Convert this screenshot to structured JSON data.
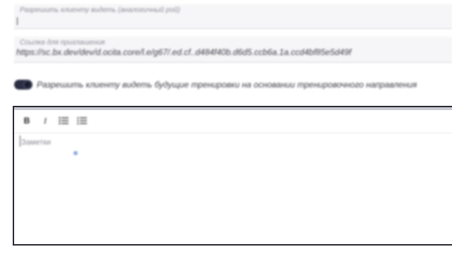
{
  "fields": {
    "field1": {
      "label": "Разрешить клиенту видеть (аналогичный рой)",
      "value": "|"
    },
    "field2": {
      "label": "Ссылка для приглашения",
      "value": "https://sc.bx.dev/dev/d.ocita.core/l.e/g67/.ed.cf..d484f40b.d6d5.ccb6a.1a.ccd4bf85e5d49f"
    }
  },
  "toggle": {
    "label": "Разрешить клиенту видеть будущие тренировки на основании тренировочного направления",
    "state": "on"
  },
  "editor": {
    "toolbar": {
      "bold_label": "B",
      "italic_label": "I",
      "bullet_list_icon": "bullet-list-icon",
      "ordered_list_icon": "ordered-list-icon"
    },
    "placeholder": "Заметки"
  },
  "colors": {
    "toggle_on": "#2b2d44",
    "field_bg": "#f6f6f8",
    "editor_border": "#2a2a33",
    "cursor_accent": "#6f92d8"
  }
}
